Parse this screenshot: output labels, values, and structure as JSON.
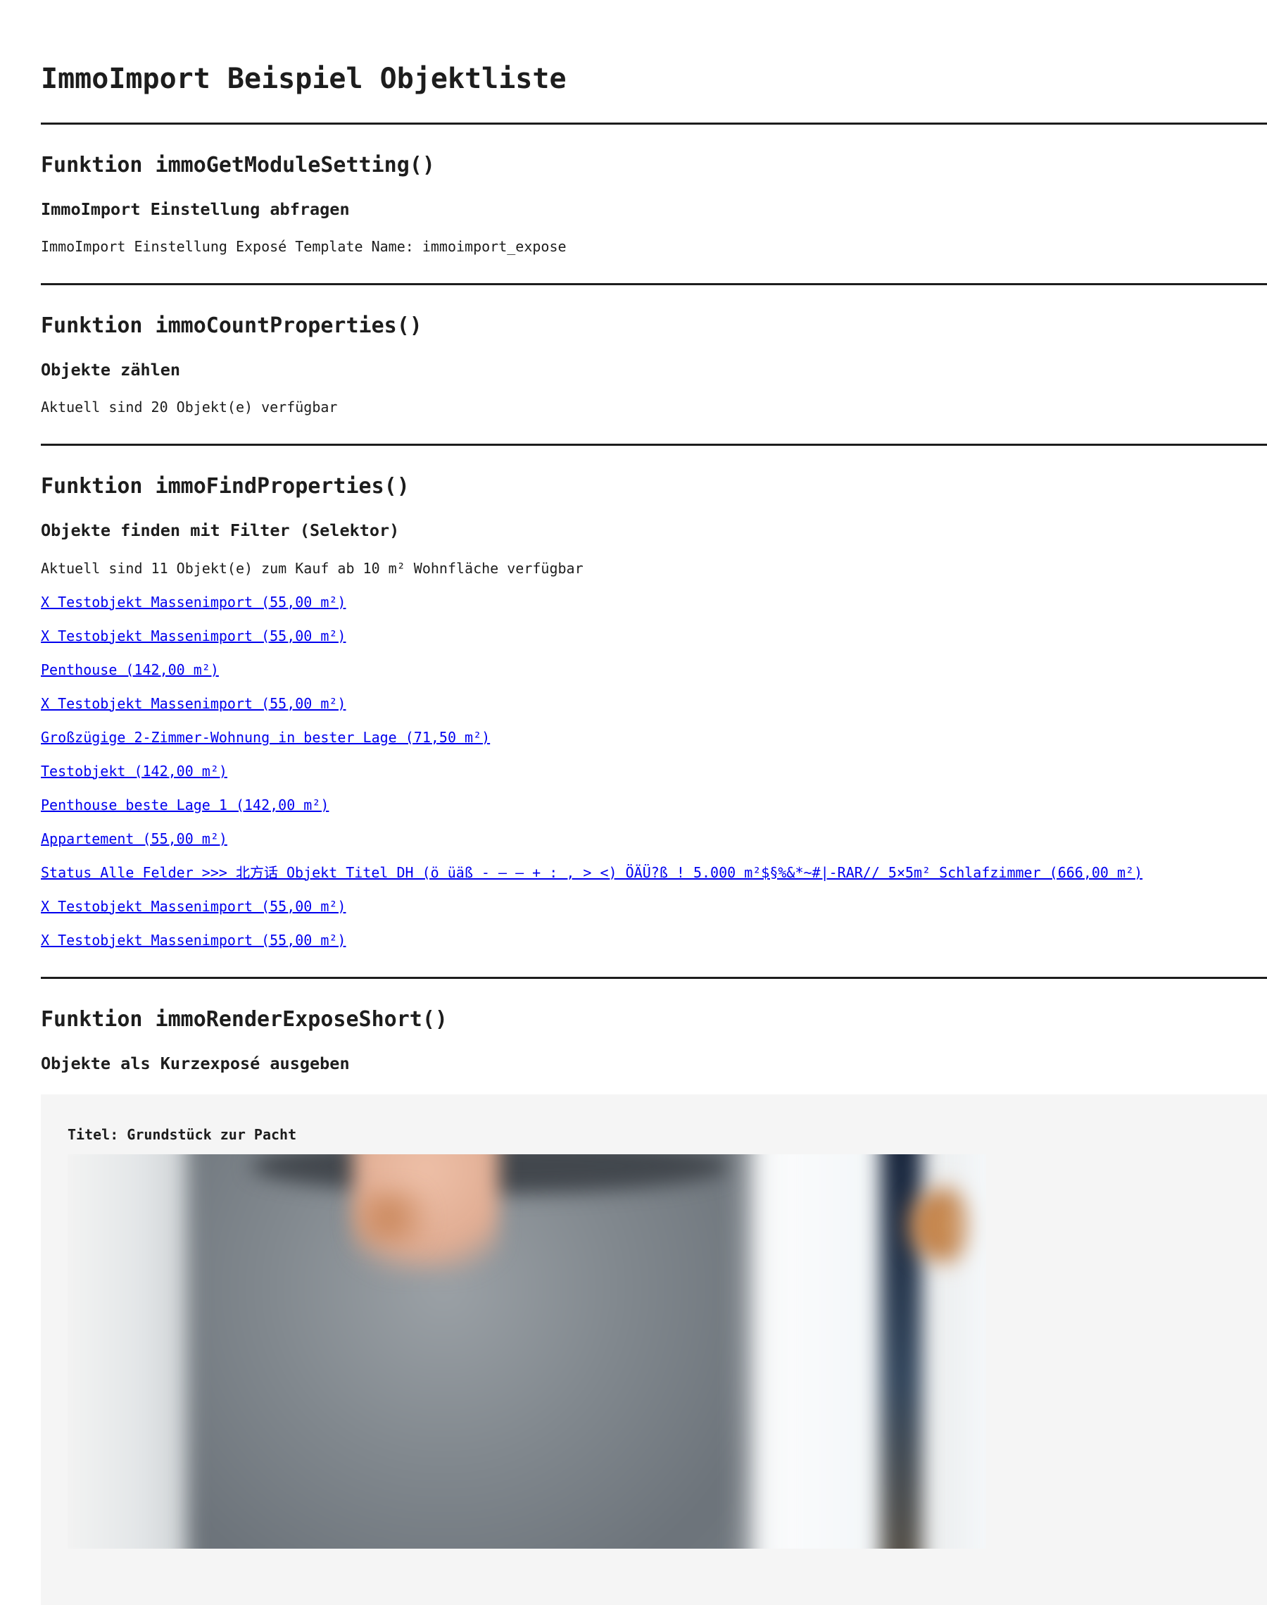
{
  "page": {
    "title": "ImmoImport Beispiel Objektliste"
  },
  "colors": {
    "text": "#1D1D1D",
    "link_blue": "#0000EE",
    "rule": "#1D1D1D",
    "card_background": "#F5F5F5"
  },
  "sections": {
    "module_setting": {
      "heading": "Funktion immoGetModuleSetting()",
      "subheading": "ImmoImport Einstellung abfragen",
      "text": "ImmoImport Einstellung Exposé Template Name: immoimport_expose"
    },
    "count_properties": {
      "heading": "Funktion immoCountProperties()",
      "subheading": "Objekte zählen",
      "text": "Aktuell sind 20 Objekt(e) verfügbar"
    },
    "find_properties": {
      "heading": "Funktion immoFindProperties()",
      "subheading": "Objekte finden mit Filter (Selektor)",
      "text": "Aktuell sind 11 Objekt(e) zum Kauf ab 10 m² Wohnfläche verfügbar",
      "links": [
        "X Testobjekt Massenimport (55,00 m²)",
        "X Testobjekt Massenimport (55,00 m²)",
        "Penthouse (142,00 m²)",
        "X Testobjekt Massenimport (55,00 m²)",
        "Großzügige 2-Zimmer-Wohnung in bester Lage (71,50 m²)",
        "Testobjekt (142,00 m²)",
        "Penthouse beste Lage 1 (142,00 m²)",
        "Appartement (55,00 m²)",
        "Status Alle Felder >>> 北方话 Objekt Titel DH (ö üäß - – — + : , > <) ÖÄÜ?ß ! 5.000 m²$§%&*~#|-RAR// 5×5m² Schlafzimmer (666,00 m²)",
        "X Testobjekt Massenimport (55,00 m²)",
        "X Testobjekt Massenimport (55,00 m²)"
      ]
    },
    "render_expose_short": {
      "heading": "Funktion immoRenderExposeShort()",
      "subheading": "Objekte als Kurzexposé ausgeben",
      "expose": {
        "title": "Titel: Grundstück zur Pacht"
      }
    }
  }
}
